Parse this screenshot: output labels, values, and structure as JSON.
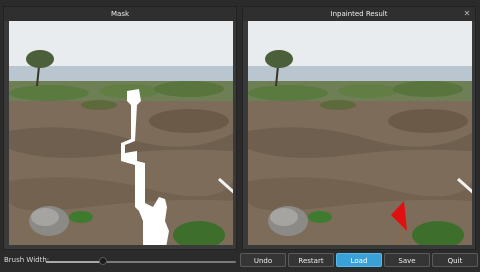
{
  "panels": {
    "mask_title": "Mask",
    "result_title": "Inpainted Result"
  },
  "controls": {
    "brush_label": "Brush Width:",
    "brush_width_fraction": 0.3
  },
  "buttons": {
    "undo": "Undo",
    "restart": "Restart",
    "load": "Load",
    "save": "Save",
    "quit": "Quit"
  },
  "icons": {
    "close": "close-icon"
  },
  "colors": {
    "active_button": "#3aa0d8",
    "mask": "#ffffff",
    "marker": "#e01010"
  }
}
